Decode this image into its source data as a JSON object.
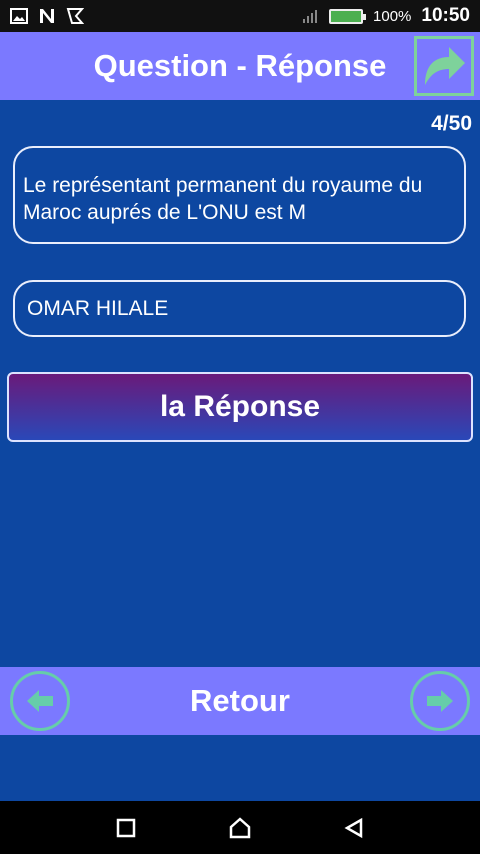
{
  "status_bar": {
    "battery_percent": "100%",
    "time": "10:50",
    "icons": [
      "image-icon",
      "n-icon",
      "vpn-icon",
      "signal-icon",
      "battery-charging-icon"
    ]
  },
  "header": {
    "title": "Question - Réponse",
    "share_icon": "share-arrow-icon"
  },
  "counter": "4/50",
  "question": {
    "text": "Le représentant permanent du royaume du Maroc auprés de L'ONU est M"
  },
  "answer": {
    "text": "OMAR HILALE"
  },
  "reponse_button": {
    "label": "la Réponse"
  },
  "bottom_bar": {
    "label": "Retour",
    "prev_icon": "arrow-left-icon",
    "next_icon": "arrow-right-icon"
  },
  "colors": {
    "background": "#0d47a1",
    "bar": "#7b79ff",
    "accent_green": "#66cdaa"
  }
}
